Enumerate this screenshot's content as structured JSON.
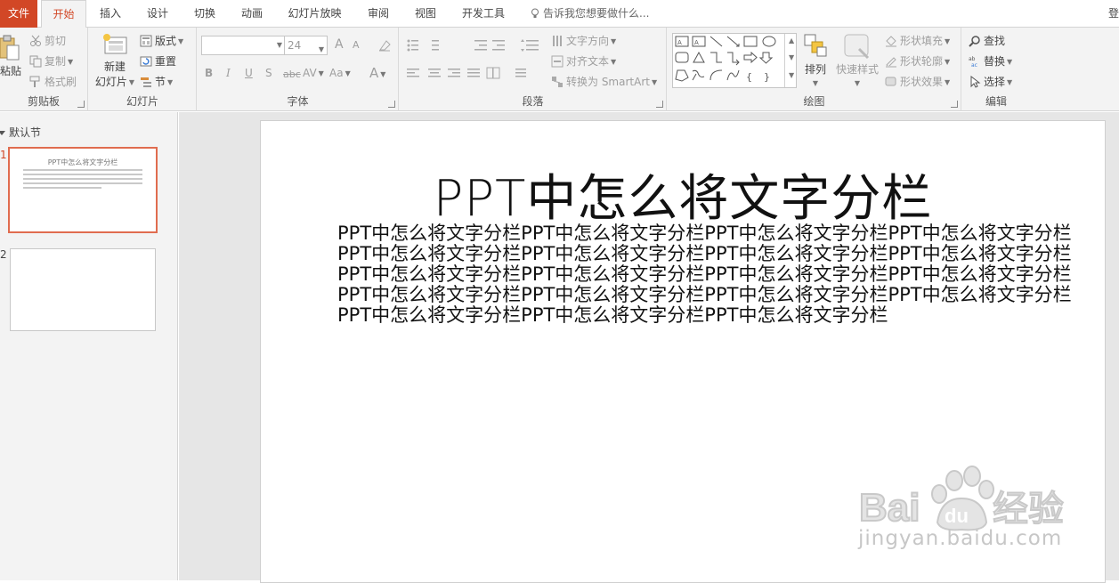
{
  "tabs": {
    "file": "文件",
    "home": "开始",
    "insert": "插入",
    "design": "设计",
    "transitions": "切换",
    "animations": "动画",
    "slideshow": "幻灯片放映",
    "review": "审阅",
    "view": "视图",
    "developer": "开发工具",
    "tell_me": "告诉我您想要做什么...",
    "signin": "登"
  },
  "ribbon": {
    "clipboard": {
      "paste": "粘贴",
      "cut": "剪切",
      "copy": "复制",
      "format_painter": "格式刷",
      "label": "剪贴板"
    },
    "slides": {
      "new_slide_line1": "新建",
      "new_slide_line2": "幻灯片",
      "layout": "版式",
      "reset": "重置",
      "section": "节",
      "label": "幻灯片"
    },
    "font": {
      "font_name": "",
      "font_size": "24",
      "bold": "B",
      "italic": "I",
      "underline": "U",
      "shadow": "S",
      "strike": "abc",
      "spacing": "AV",
      "case": "Aa",
      "color": "A",
      "grow": "A",
      "shrink": "A",
      "label": "字体"
    },
    "paragraph": {
      "text_direction": "文字方向",
      "align_text": "对齐文本",
      "smartart": "转换为 SmartArt",
      "label": "段落"
    },
    "drawing": {
      "arrange": "排列",
      "quick_styles": "快速样式",
      "shape_fill": "形状填充",
      "shape_outline": "形状轮廓",
      "shape_effects": "形状效果",
      "label": "绘图"
    },
    "editing": {
      "find": "查找",
      "replace": "替换",
      "select": "选择",
      "label": "编辑"
    }
  },
  "left_pane": {
    "section": "默认节",
    "slide1_number": "1",
    "slide1_title": "PPT中怎么将文字分栏",
    "slide2_number": "2"
  },
  "slide": {
    "title": "PPT中怎么将文字分栏",
    "body": "PPT中怎么将文字分栏PPT中怎么将文字分栏PPT中怎么将文字分栏PPT中怎么将文字分栏PPT中怎么将文字分栏PPT中怎么将文字分栏PPT中怎么将文字分栏PPT中怎么将文字分栏PPT中怎么将文字分栏PPT中怎么将文字分栏PPT中怎么将文字分栏PPT中怎么将文字分栏PPT中怎么将文字分栏PPT中怎么将文字分栏PPT中怎么将文字分栏PPT中怎么将文字分栏PPT中怎么将文字分栏PPT中怎么将文字分栏PPT中怎么将文字分栏"
  },
  "watermark": {
    "brand": "Baidu经验",
    "url": "jingyan.baidu.com"
  },
  "colors": {
    "accent": "#d24726",
    "selection": "#e06c4f",
    "ribbon_bg": "#f3f3f3",
    "canvas_bg": "#e6e6e6"
  }
}
